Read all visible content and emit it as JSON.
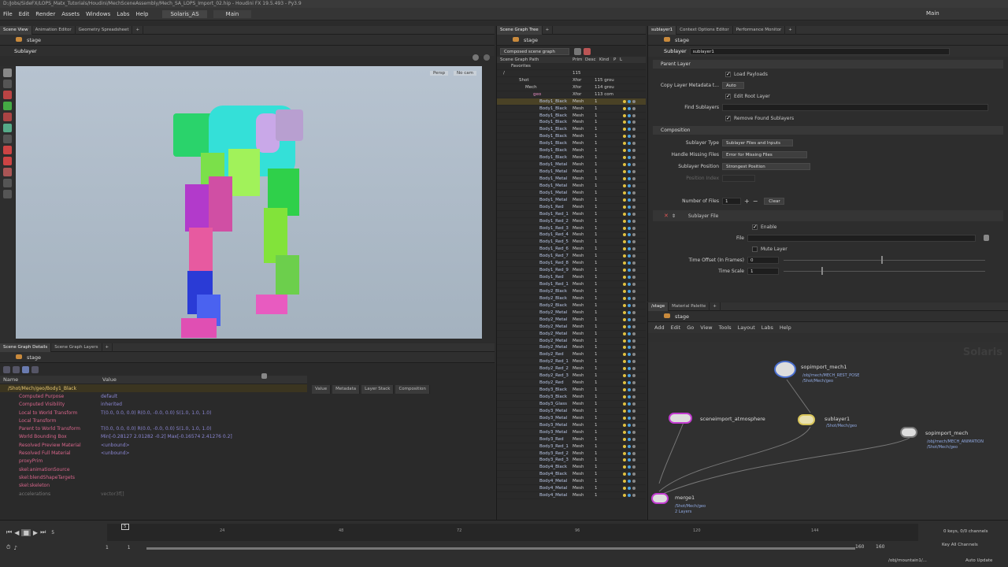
{
  "window": {
    "title": "D:/Jobs/SideFX/LOPS_Matx_Tutorials/Houdini/MechSceneAssembly/Mech_SA_LOPS_Import_02.hip - Houdini FX 19.5.493 - Py3.9"
  },
  "menubar": {
    "items": [
      "File",
      "Edit",
      "Render",
      "Assets",
      "Windows",
      "Labs",
      "Help"
    ],
    "desktop": "Solaris_AS",
    "main": "Main",
    "right_main": "Main"
  },
  "left_top": {
    "tabs": [
      "Scene View",
      "Animation Editor",
      "Geometry Spreadsheet"
    ],
    "path": "stage",
    "context": "Sublayer",
    "persp": "Persp",
    "nocam": "No cam"
  },
  "left_bottom": {
    "tabs": [
      "Scene Graph Details",
      "Scene Graph Layers"
    ],
    "path": "stage",
    "headers": {
      "name": "Name",
      "value": "Value"
    },
    "right_tabs": [
      "Value",
      "Metadata",
      "Layer Stack",
      "Composition"
    ],
    "prim_path": "/Shot/Mech/geo/Body1_Black",
    "props": [
      {
        "k": "Computed Purpose",
        "v": "default"
      },
      {
        "k": "Computed Visibility",
        "v": "inherited"
      },
      {
        "k": "Local to World Transform",
        "v": "T(0.0, 0.0, 0.0) R(0.0, -0.0, 0.0) S(1.0, 1.0, 1.0)"
      },
      {
        "k": "Local Transform",
        "v": ""
      },
      {
        "k": "Parent to World Transform",
        "v": "T(0.0, 0.0, 0.0) R(0.0, -0.0, 0.0) S(1.0, 1.0, 1.0)"
      },
      {
        "k": "World Bounding Box",
        "v": "Min[-0.28127 2.01282 -0.2] Max[-0.16574 2.41276 0.2]"
      },
      {
        "k": "Resolved Preview Material",
        "v": "<unbound>"
      },
      {
        "k": "Resolved Full Material",
        "v": "<unbound>"
      },
      {
        "k": "proxyPrim",
        "v": ""
      },
      {
        "k": "skel:animationSource",
        "v": ""
      },
      {
        "k": "skel:blendShapeTargets",
        "v": ""
      },
      {
        "k": "skel:skeleton",
        "v": ""
      },
      {
        "k": "accelerations",
        "v": "vector3f[]"
      }
    ]
  },
  "scene_tree": {
    "tab": "Scene Graph Tree",
    "path": "stage",
    "mode": "Composed scene graph",
    "headers": {
      "path": "Scene Graph Path",
      "prim": "Prim",
      "desc": "Desc",
      "kind": "Kind",
      "p": "P",
      "l": "L"
    },
    "favorites": "Favorites",
    "root": "/",
    "root_count": "115",
    "shot": {
      "name": "Shot",
      "kind": "Xfor",
      "desc": "115 grou"
    },
    "mech": {
      "name": "Mech",
      "kind": "Xfor",
      "desc": "114 grou"
    },
    "geo": {
      "name": "geo",
      "kind": "Xfor",
      "desc": "113 com"
    },
    "rows": [
      "Body1_Black",
      "Body1_Black",
      "Body1_Black",
      "Body1_Black",
      "Body1_Black",
      "Body1_Black",
      "Body1_Black",
      "Body1_Black",
      "Body1_Black",
      "Body1_Metal",
      "Body1_Metal",
      "Body1_Metal",
      "Body1_Metal",
      "Body1_Metal",
      "Body1_Metal",
      "Body1_Red",
      "Body1_Red_1",
      "Body1_Red_2",
      "Body1_Red_3",
      "Body1_Red_4",
      "Body1_Red_5",
      "Body1_Red_6",
      "Body1_Red_7",
      "Body1_Red_8",
      "Body1_Red_9",
      "Body1_Red",
      "Body1_Red_1",
      "Body2_Black",
      "Body2_Black",
      "Body2_Black",
      "Body2_Metal",
      "Body2_Metal",
      "Body2_Metal",
      "Body2_Metal",
      "Body2_Metal",
      "Body2_Metal",
      "Body2_Red",
      "Body2_Red_1",
      "Body2_Red_2",
      "Body2_Red_3",
      "Body2_Red",
      "Body3_Black",
      "Body3_Black",
      "Body3_Glass",
      "Body3_Metal",
      "Body3_Metal",
      "Body3_Metal",
      "Body3_Metal",
      "Body3_Red",
      "Body3_Red_1",
      "Body3_Red_2",
      "Body3_Red_3",
      "Body4_Black",
      "Body4_Black",
      "Body4_Metal",
      "Body4_Metal",
      "Body4_Metal"
    ],
    "row_kind": "Mesh",
    "row_desc": "1"
  },
  "params": {
    "tabs": [
      "sublayer1",
      "Context Options Editor",
      "Performance Monitor"
    ],
    "path": "stage",
    "node_type": "Sublayer",
    "node_name": "sublayer1",
    "sections": {
      "parent": "Parent Layer",
      "composition": "Composition",
      "sublayer_file": "Sublayer File"
    },
    "load_payloads": "Load Payloads",
    "copy_meta_label": "Copy Layer Metadata t...",
    "copy_meta_value": "Auto",
    "edit_root": "Edit Root Layer",
    "find_label": "Find Sublayers",
    "remove_found": "Remove Found Sublayers",
    "type_label": "Sublayer Type",
    "type_value": "Sublayer Files and Inputs",
    "missing_label": "Handle Missing Files",
    "missing_value": "Error for Missing Files",
    "position_label": "Sublayer Position",
    "position_value": "Strongest Position",
    "pos_index_label": "Position Index",
    "num_files_label": "Number of Files",
    "num_files_value": "1",
    "clear": "Clear",
    "enable": "Enable",
    "file_label": "File",
    "mute": "Mute Layer",
    "time_offset_label": "Time Offset (In Frames)",
    "time_offset_value": "0",
    "time_scale_label": "Time Scale",
    "time_scale_value": "1"
  },
  "network": {
    "tabs": [
      "/stage",
      "Material Palette"
    ],
    "path": "stage",
    "menu": [
      "Add",
      "Edit",
      "Go",
      "View",
      "Tools",
      "Layout",
      "Labs",
      "Help"
    ],
    "watermark": "Solaris",
    "nodes": [
      {
        "id": "sopimport_mech1",
        "label": "sopimport_mech1",
        "sub1": "/obj/mech/MECH_REST_POSE",
        "sub2": "/Shot/Mech/geo"
      },
      {
        "id": "sublayer1",
        "label": "sublayer1",
        "sub1": "/Shot/Mech/geo",
        "sub2": ""
      },
      {
        "id": "sceneimport_atmosphere",
        "label": "sceneimport_atmosphere",
        "sub1": "",
        "sub2": ""
      },
      {
        "id": "sopimport_mech",
        "label": "sopimport_mech",
        "sub1": "/obj/mech/MECH_ANIMATION",
        "sub2": "/Shot/Mech/geo"
      },
      {
        "id": "merge1",
        "label": "merge1",
        "sub1": "/Shot/Mech/geo",
        "sub2": "2 Layers"
      }
    ]
  },
  "timeline": {
    "frame": "5",
    "ticks": [
      "24",
      "48",
      "72",
      "96",
      "120",
      "144"
    ],
    "start": "1",
    "start2": "1",
    "end": "160",
    "end2": "160",
    "keys": "0 keys, 0/0 channels",
    "key_all": "Key All Channels",
    "status_path": "/obj/mountain1/...",
    "auto_update": "Auto Update"
  }
}
